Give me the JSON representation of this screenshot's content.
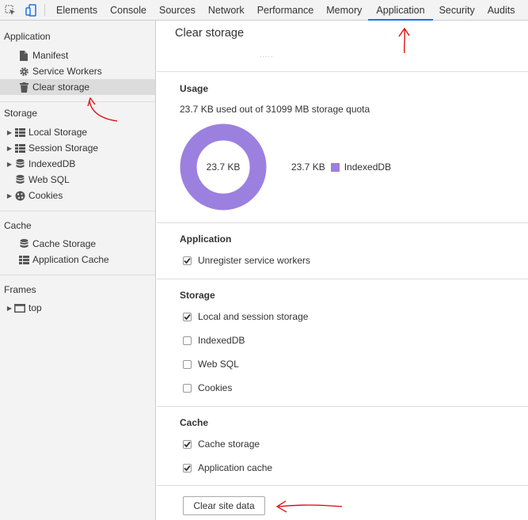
{
  "toolbar": {
    "tabs": [
      "Elements",
      "Console",
      "Sources",
      "Network",
      "Performance",
      "Memory",
      "Application",
      "Security",
      "Audits"
    ],
    "active_tab": "Application"
  },
  "sidebar": {
    "application": {
      "title": "Application",
      "items": [
        {
          "label": "Manifest",
          "icon": "document-icon"
        },
        {
          "label": "Service Workers",
          "icon": "gear-icon"
        },
        {
          "label": "Clear storage",
          "icon": "trash-icon",
          "selected": true
        }
      ]
    },
    "storage": {
      "title": "Storage",
      "items": [
        {
          "label": "Local Storage",
          "icon": "grid-icon",
          "expandable": true
        },
        {
          "label": "Session Storage",
          "icon": "grid-icon",
          "expandable": true
        },
        {
          "label": "IndexedDB",
          "icon": "database-icon",
          "expandable": true
        },
        {
          "label": "Web SQL",
          "icon": "database-icon",
          "expandable": false
        },
        {
          "label": "Cookies",
          "icon": "cookie-icon",
          "expandable": true
        }
      ]
    },
    "cache": {
      "title": "Cache",
      "items": [
        {
          "label": "Cache Storage",
          "icon": "database-icon"
        },
        {
          "label": "Application Cache",
          "icon": "grid-icon"
        }
      ]
    },
    "frames": {
      "title": "Frames",
      "items": [
        {
          "label": "top",
          "icon": "frame-icon",
          "expandable": true
        }
      ]
    }
  },
  "main": {
    "title": "Clear storage",
    "usage": {
      "heading": "Usage",
      "summary": "23.7 KB used out of 31099 MB storage quota",
      "donut_center": "23.7 KB",
      "legend_value": "23.7 KB",
      "legend_label": "IndexedDB",
      "color": "#9c80e0"
    },
    "application": {
      "heading": "Application",
      "options": [
        {
          "label": "Unregister service workers",
          "checked": true
        }
      ]
    },
    "storage": {
      "heading": "Storage",
      "options": [
        {
          "label": "Local and session storage",
          "checked": true
        },
        {
          "label": "IndexedDB",
          "checked": false
        },
        {
          "label": "Web SQL",
          "checked": false
        },
        {
          "label": "Cookies",
          "checked": false
        }
      ]
    },
    "cache": {
      "heading": "Cache",
      "options": [
        {
          "label": "Cache storage",
          "checked": true
        },
        {
          "label": "Application cache",
          "checked": true
        }
      ]
    },
    "clear_button": "Clear site data"
  },
  "colors": {
    "accent": "#1a73e8",
    "annotation": "#e00000",
    "indexeddb": "#9c80e0"
  }
}
